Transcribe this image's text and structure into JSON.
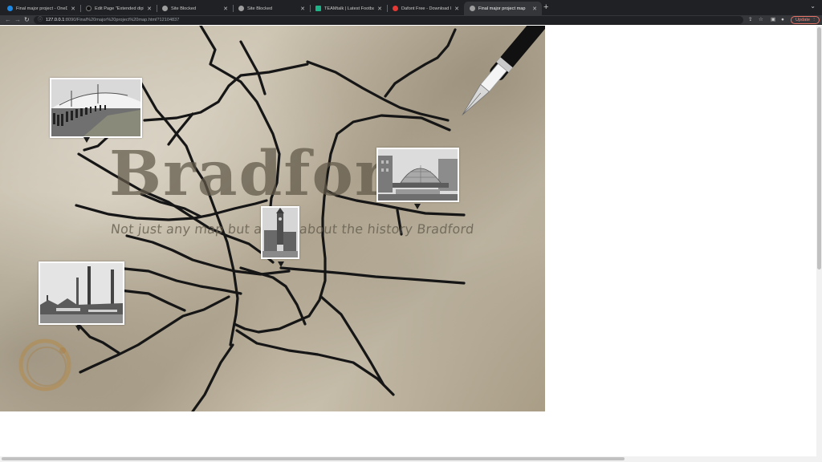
{
  "browser": {
    "tabs": [
      {
        "title": "Final major project - OneDrive",
        "favicon_color": "#1e88e5",
        "active": false
      },
      {
        "title": "Edit Page \"Extended diploma\"",
        "favicon_color": "#111111",
        "active": false
      },
      {
        "title": "Site Blocked",
        "favicon_color": "#9e9e9e",
        "active": false
      },
      {
        "title": "Site Blocked",
        "favicon_color": "#9e9e9e",
        "active": false
      },
      {
        "title": "TEAMtalk | Latest Football Ne",
        "favicon_color": "#1db389",
        "active": false
      },
      {
        "title": "Dafont Free - Download Fonts",
        "favicon_color": "#e53935",
        "active": false
      },
      {
        "title": "Final major project map",
        "favicon_color": "#9e9e9e",
        "active": true
      }
    ],
    "new_tab_label": "+",
    "tab_menu_icon": "chevron-down-icon",
    "address_host": "127.0.0.1",
    "address_path": ":8090/Final%20major%20project%20map.html?12104837",
    "update_label": "Update",
    "colors": {
      "update_accent": "#f28b82"
    }
  },
  "map": {
    "title": "Bradford",
    "subtitle": "Not just any map but a map about the history Bradford",
    "photos": [
      {
        "name": "photo-crowd-tent",
        "alt": "crowd"
      },
      {
        "name": "photo-glass-dome",
        "alt": "dome"
      },
      {
        "name": "photo-clock-tower",
        "alt": "tower"
      },
      {
        "name": "photo-mill-chimneys",
        "alt": "mill"
      }
    ]
  }
}
